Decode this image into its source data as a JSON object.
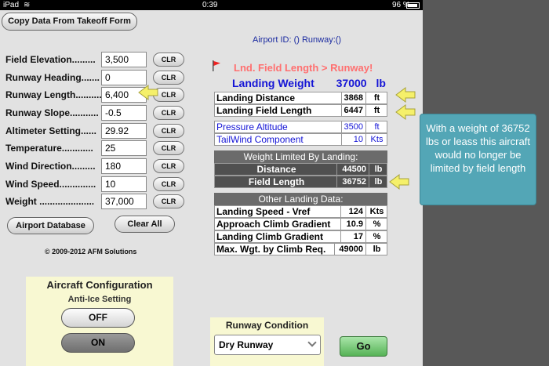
{
  "status_bar": {
    "carrier": "iPad",
    "time": "0:39",
    "battery": "96 %",
    "battery_level": 0.96
  },
  "top_button": "Copy Data From Takeoff Form",
  "airport_id": "Airport ID: () Runway:()",
  "fields": [
    {
      "label": "Field Elevation.........",
      "value": "3,500",
      "clr": "CLR"
    },
    {
      "label": "Runway Heading.......",
      "value": "0",
      "clr": "CLR"
    },
    {
      "label": "Runway Length..........",
      "value": "6,400",
      "clr": "CLR"
    },
    {
      "label": "Runway Slope...........",
      "value": "-0.5",
      "clr": "CLR"
    },
    {
      "label": "Altimeter Setting......",
      "value": "29.92",
      "clr": "CLR"
    },
    {
      "label": "Temperature............",
      "value": "25",
      "clr": "CLR"
    },
    {
      "label": "Wind Direction.........",
      "value": "180",
      "clr": "CLR"
    },
    {
      "label": "Wind Speed..............",
      "value": "10",
      "clr": "CLR"
    },
    {
      "label": "Weight .....................",
      "value": "37,000",
      "clr": "CLR"
    }
  ],
  "airport_db_button": "Airport Database",
  "clear_all_button": "Clear All",
  "copyright": "© 2009-2012 AFM Solutions",
  "aircraft_config": {
    "title": "Aircraft Configuration",
    "subtitle": "Anti-Ice Setting",
    "off_label": "OFF",
    "on_label": "ON"
  },
  "warning": "Lnd. Field Length > Runway!",
  "landing_weight": {
    "label": "Landing Weight",
    "value": "37000",
    "unit": "lb"
  },
  "landing_rows": [
    {
      "label": "Landing Distance",
      "value": "3868",
      "unit": "ft"
    },
    {
      "label": "Landing Field Length",
      "value": "6447",
      "unit": "ft"
    }
  ],
  "atmos_rows": [
    {
      "label": "Pressure Altitude",
      "value": "3500",
      "unit": "ft"
    },
    {
      "label": "TailWind Component",
      "value": "10",
      "unit": "Kts"
    }
  ],
  "weight_limited": {
    "header": "Weight Limited By Landing:",
    "rows": [
      {
        "label": "Distance",
        "value": "44500",
        "unit": "lb"
      },
      {
        "label": "Field Length",
        "value": "36752",
        "unit": "lb"
      }
    ]
  },
  "other_data": {
    "header": "Other Landing Data:",
    "rows": [
      {
        "label": "Landing Speed - Vref",
        "value": "124",
        "unit": "Kts"
      },
      {
        "label": "Approach Climb Gradient",
        "value": "10.9",
        "unit": "%"
      },
      {
        "label": "Landing Climb Gradient",
        "value": "17",
        "unit": "%"
      },
      {
        "label": "Max. Wgt. by Climb Req.",
        "value": "49000",
        "unit": "lb"
      }
    ]
  },
  "runway_condition": {
    "title": "Runway Condition",
    "selected": "Dry Runway"
  },
  "go_button": "Go",
  "callout": "With a weight of 36752 lbs or leass this aircraft would no longer be limited by field length",
  "colors": {
    "warning": "#ff7070",
    "accent_blue": "#1414d6",
    "callout": "#53a6b6",
    "go": "#56b356"
  }
}
